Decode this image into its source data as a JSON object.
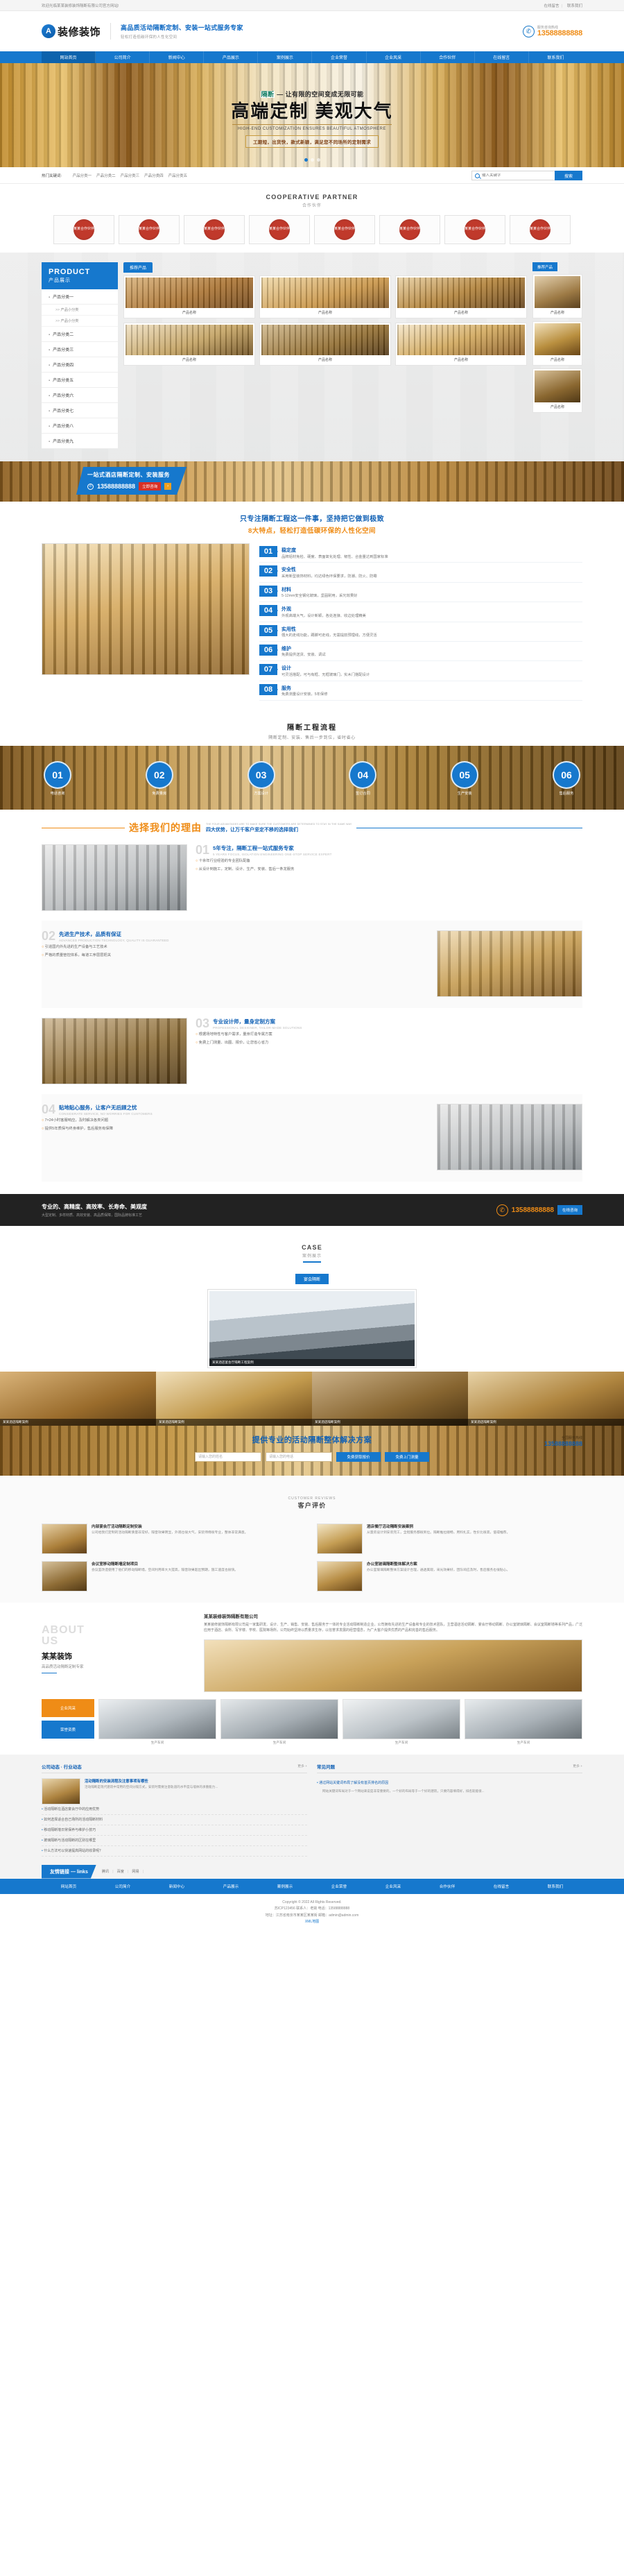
{
  "topbar": {
    "welcome": "欢迎光临某某装修装饰隔断有限公司官方网站!",
    "links": [
      "在线留言",
      "联系我们"
    ]
  },
  "header": {
    "logo_text": "装修装饰",
    "logo_mark": "logo-icon",
    "slogan_main": "高品质活动隔断定制、安装一站式服务专家",
    "slogan_sub": "轻松打造低碳环保的人性化空间",
    "hotline_label": "服务咨询热线",
    "hotline_number": "13588888888"
  },
  "nav": {
    "items": [
      "网站首页",
      "公司简介",
      "新闻中心",
      "产品展示",
      "案例展示",
      "企业荣誉",
      "企业风采",
      "合作伙伴",
      "在线留言",
      "联系我们"
    ],
    "active_index": 0
  },
  "banner": {
    "line1_tag": "隔断",
    "line1_rest": "— 让有限的空间变成无限可能",
    "headline": "高端定制  美观大气",
    "english": "HIGH-END CUSTOMIZATION ENSURES BEAUTIFUL ATMOSPHERE",
    "chip": "工期短，出货快，款式新颖，满足您不同场所的定制需求",
    "dots": 3,
    "active_dot": 0
  },
  "search": {
    "keyword_label": "热门关键词:",
    "keywords": [
      "产品分类一",
      "产品分类二",
      "产品分类三",
      "产品分类四",
      "产品分类五"
    ],
    "placeholder": "输入关键字",
    "button": "搜索",
    "icon": "search-icon"
  },
  "partners": {
    "title_en": "COOPERATIVE PARTNER",
    "title_cn": "合作伙伴",
    "items": [
      {
        "label": "某某合作伙伴"
      },
      {
        "label": "某某合作伙伴"
      },
      {
        "label": "某某合作伙伴"
      },
      {
        "label": "某某合作伙伴"
      },
      {
        "label": "某某合作伙伴"
      },
      {
        "label": "某某合作伙伴"
      },
      {
        "label": "某某合作伙伴"
      },
      {
        "label": "某某合作伙伴"
      }
    ]
  },
  "product": {
    "side_en": "PRODUCT",
    "side_cn": "产品展示",
    "categories": [
      {
        "name": "产品分类一",
        "subs": [
          "产品小分类",
          "产品小分类"
        ]
      },
      {
        "name": "产品分类二",
        "subs": []
      },
      {
        "name": "产品分类三",
        "subs": []
      },
      {
        "name": "产品分类四",
        "subs": []
      },
      {
        "name": "产品分类五",
        "subs": []
      },
      {
        "name": "产品分类六",
        "subs": []
      },
      {
        "name": "产品分类七",
        "subs": []
      },
      {
        "name": "产品分类八",
        "subs": []
      },
      {
        "name": "产品分类九",
        "subs": []
      }
    ],
    "tab": "推荐产品",
    "rec_tab": "推荐产品",
    "items": [
      {
        "name": "产品名称"
      },
      {
        "name": "产品名称"
      },
      {
        "name": "产品名称"
      },
      {
        "name": "产品名称"
      },
      {
        "name": "产品名称"
      },
      {
        "name": "产品名称"
      }
    ],
    "recommended": [
      {
        "name": "产品名称"
      },
      {
        "name": "产品名称"
      },
      {
        "name": "产品名称"
      }
    ]
  },
  "strip": {
    "title": "一站式酒店隔断定制、安装服务",
    "phone": "13588888888",
    "cta": "立即咨询",
    "arrow": "›",
    "phone_icon": "phone-icon"
  },
  "features": {
    "head1": "只专注隔断工程这一件事，坚持把它做到极致",
    "head2": "8大特点，轻松打造低碳环保的人性化空间",
    "items": [
      {
        "no": "01",
        "title": "稳定度",
        "desc": "品牌铝材免检、硬度、表面氧化处理、韧性、合金量达到国家标准"
      },
      {
        "no": "02",
        "title": "安全性",
        "desc": "采用新型装饰材料，均达绿色环保要求，防潮、防火、防霉"
      },
      {
        "no": "03",
        "title": "材料",
        "desc": "5-12mm安全钢化玻璃，坚固耐用，采光效果好"
      },
      {
        "no": "04",
        "title": "外观",
        "desc": "外观高端大气，设计新颖，各处连接、收边处理精美"
      },
      {
        "no": "05",
        "title": "实用性",
        "desc": "强大的走线功能，踢脚可走线，无需提前预埋线，方便灵活"
      },
      {
        "no": "06",
        "title": "维护",
        "desc": "免费提供送货、安装、调试"
      },
      {
        "no": "07",
        "title": "设计",
        "desc": "可灵活搭配，可与有框、无框玻璃门，实木门搭配设计"
      },
      {
        "no": "08",
        "title": "服务",
        "desc": "免费测量设计安装，5年保修"
      }
    ]
  },
  "process": {
    "title": "隔断工程流程",
    "subtitle": "隔断定制、安装、售后一步到位，省时省心",
    "steps": [
      {
        "no": "01",
        "label": "电话咨询"
      },
      {
        "no": "02",
        "label": "免费量房"
      },
      {
        "no": "03",
        "label": "方案设计"
      },
      {
        "no": "04",
        "label": "签订合同"
      },
      {
        "no": "05",
        "label": "生产安装"
      },
      {
        "no": "06",
        "label": "售后服务"
      }
    ]
  },
  "reasons": {
    "title": "选择我们的理由",
    "sub_en": "THE FOUR ADVANTAGES ARE TO MAKE SURE THE CUSTOMERS ARE DETERMINED TO STAY IN THE SAME WAY",
    "sub_cn": "四大优势，让万千客户坚定不移的选择我们",
    "blocks": [
      {
        "no": "01",
        "title": "5年专注，隔断工程一站式服务专家",
        "en": "5 YEARS FOCUS, ISOLATION ENGINEERING ONE-STOP SERVICE EXPERT",
        "bullets": [
          "十余年行业经验的专业团队配备",
          "从设计到施工，定制、设计、生产、安装、售后一条龙服务"
        ]
      },
      {
        "no": "02",
        "title": "先进生产技术，品质有保证",
        "en": "ADVANCED PRODUCTION TECHNOLOGY, QUALITY IS GUARANTEED",
        "bullets": [
          "引进国内外先进的生产设备与工艺技术",
          "严格的质量管控体系，每道工序层层把关"
        ]
      },
      {
        "no": "03",
        "title": "专业设计师，量身定制方案",
        "en": "PROFESSIONAL DESIGNER, TAILOR-MADE SOLUTIONS",
        "bullets": [
          "根据场地特性与客户需求，量身打造专属方案",
          "免费上门测量、出图、报价，让您省心省力"
        ]
      },
      {
        "no": "04",
        "title": "贴地贴心服务，让客户无后顾之忧",
        "en": "CONSIDERATE SERVICE, NO WORRIES FOR CUSTOMERS",
        "bullets": [
          "7×24小时客服响应，及时解决各类问题",
          "提供5年质保与终身维护，售后服务有保障"
        ]
      }
    ]
  },
  "dark_cta": {
    "title": "专业的、高精度、高效率、长寿命、美观度",
    "subtitle": "大型定制、多样材质、高效安装、高品质保障，国际品牌标准工艺",
    "phone": "13588888888",
    "button": "在线咨询",
    "phone_icon": "phone-icon"
  },
  "case": {
    "title_en": "CASE",
    "title_cn": "案例展示",
    "tab": "宴会隔断",
    "hero_caption": "某某酒店宴会厅隔断工程案例",
    "thumbs": [
      {
        "caption": "某某酒店隔断案例"
      },
      {
        "caption": "某某酒店隔断案例"
      },
      {
        "caption": "某某酒店隔断案例"
      },
      {
        "caption": "某某酒店隔断案例"
      }
    ]
  },
  "orange_cta": {
    "title": "提供专业的活动隔断整体解决方案",
    "hotline_label": "全国服务热线",
    "hotline": "13588888888",
    "fields": [
      {
        "placeholder": "请输入您的姓名"
      },
      {
        "placeholder": "请输入您的电话"
      }
    ],
    "buttons": [
      "免费获取报价",
      "免费上门测量"
    ]
  },
  "reviews": {
    "title_en": "CUSTOMER REVIEWS",
    "title_cn": "客户评价",
    "items": [
      {
        "title": "内部宴会厅活动隔断定制安装",
        "desc": "公司给我们定制的活动隔断质量非常好，隔音效果明显，外观也很大气，安装师傅很专业，整体非常满意。"
      },
      {
        "title": "酒店餐厅活动隔断安装案例",
        "desc": "从量房设计到安装完工，全程服务都很到位。隔断推拉顺畅，用料扎实，性价比很高，值得推荐。"
      },
      {
        "title": "会议室移动隔断墙定制项目",
        "desc": "会议室改造使用了他们的移动隔断墙，空间利用率大大提高，隔音效果超出预期，施工速度也很快。"
      },
      {
        "title": "办公室玻璃隔断整体解决方案",
        "desc": "办公室玻璃隔断整体方案设计合理，通透美观，采光效果好，团队响应及时，售后服务也很贴心。"
      }
    ]
  },
  "about": {
    "en_line1": "ABOUT",
    "en_line2": "US",
    "cn": "某某装饰",
    "sub": "高品质活动隔断定制专家",
    "heading": "某某装修装饰隔断有限公司",
    "paragraph": "某某装修装饰隔断有限公司是一家集研发、设计、生产、销售、安装、售后服务于一体的专业活动隔断制造企业。公司拥有先进的生产设备和专业的技术团队，主营酒店活动隔断、宴会厅移动隔断、办公室玻璃隔断、会议室隔断墙等系列产品，广泛应用于酒店、会所、写字楼、学校、医院等场所。公司始终坚持以质量求生存，以信誉求发展的经营理念，为广大客户提供优质的产品和完善的售后服务。",
    "gallery_buttons": [
      "企业风采",
      "荣誉资质"
    ],
    "gallery": [
      {
        "caption": "生产车间"
      },
      {
        "caption": "生产车间"
      },
      {
        "caption": "生产车间"
      },
      {
        "caption": "生产车间"
      }
    ]
  },
  "news": {
    "left": {
      "title": "公司动态 · 行业动态",
      "more": "更多 +",
      "feature": {
        "title": "活动隔断的安装流程及注意事项有哪些",
        "desc": "活动隔断是现代建筑中常用的空间分隔方式，安装时需要注意轨道的水平度与墙体的承重能力..."
      },
      "items": [
        "活动隔断在酒店宴会厅中的应用优势",
        "如何选择适合自己场所的活动隔断材料",
        "移动隔断墙日常保养与维护小技巧",
        "玻璃隔断与活动隔断的区别在哪里",
        "什么方法可以快速提高网站的收录呢？"
      ]
    },
    "right": {
      "title": "常见问题",
      "more": "更多 +",
      "items": [
        "通过网站关键词布局了解没有首页排名的原因"
      ],
      "answer": "网站关键词布局对于一个网站来说是非常重要的，一个好的布局等于一个好的建筑，只要内容填得好，排名就能很..."
    },
    "links_tag": "友情链接 — links",
    "links": [
      "腾讯",
      "百度",
      "网易"
    ]
  },
  "footer": {
    "nav": [
      "网站首页",
      "公司简介",
      "新闻中心",
      "产品展示",
      "案例展示",
      "企业荣誉",
      "企业风采",
      "合作伙伴",
      "在线留言",
      "联系我们"
    ],
    "copyright": "Copyright © 2022 All Rights Reserved.",
    "icp": "苏ICP123456 联系人：老姚 电话：13588888888",
    "address": "地址：江苏省南京市某某区某某街    邮箱：admin@admin.com",
    "xml": "XML地图"
  }
}
